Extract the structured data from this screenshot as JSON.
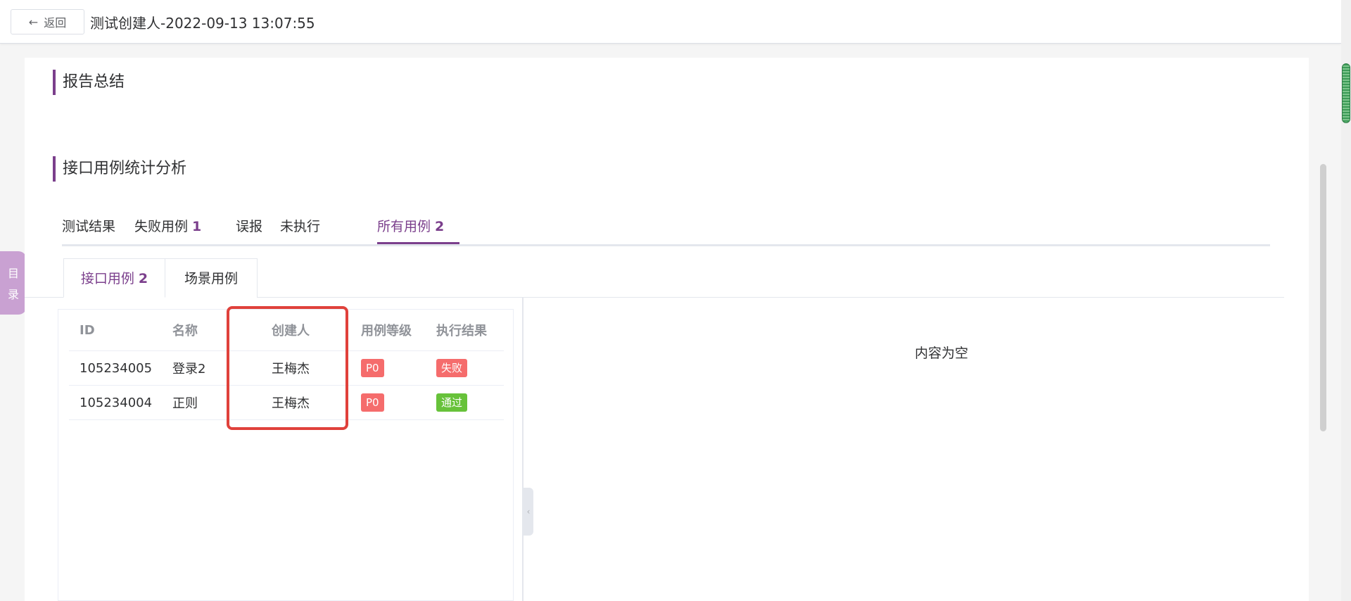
{
  "header": {
    "back_label": "返回",
    "title": "测试创建人-2022-09-13 13:07:55"
  },
  "toc": {
    "label_top": "目",
    "label_bottom": "录"
  },
  "sections": {
    "summary_title": "报告总结",
    "analysis_title": "接口用例统计分析"
  },
  "outer_tabs": [
    {
      "label": "测试结果",
      "count": ""
    },
    {
      "label": "失败用例",
      "count": "1"
    },
    {
      "label": "误报",
      "count": ""
    },
    {
      "label": "未执行",
      "count": ""
    },
    {
      "label": "所有用例",
      "count": "2",
      "active": true
    }
  ],
  "inner_tabs": [
    {
      "label": "接口用例",
      "count": "2",
      "active": true
    },
    {
      "label": "场景用例",
      "count": ""
    }
  ],
  "table": {
    "columns": [
      "ID",
      "名称",
      "创建人",
      "用例等级",
      "执行结果"
    ],
    "rows": [
      {
        "id": "105234005",
        "name": "登录2",
        "creator": "王梅杰",
        "level": "P0",
        "result": "失败",
        "result_color": "#f56c6c"
      },
      {
        "id": "105234004",
        "name": "正则",
        "creator": "王梅杰",
        "level": "P0",
        "result": "通过",
        "result_color": "#67c23a"
      }
    ]
  },
  "detail": {
    "empty_text": "内容为空"
  },
  "colors": {
    "accent": "#7b3f8c",
    "level_tag": "#f56c6c",
    "highlight_box": "#e0413b"
  }
}
